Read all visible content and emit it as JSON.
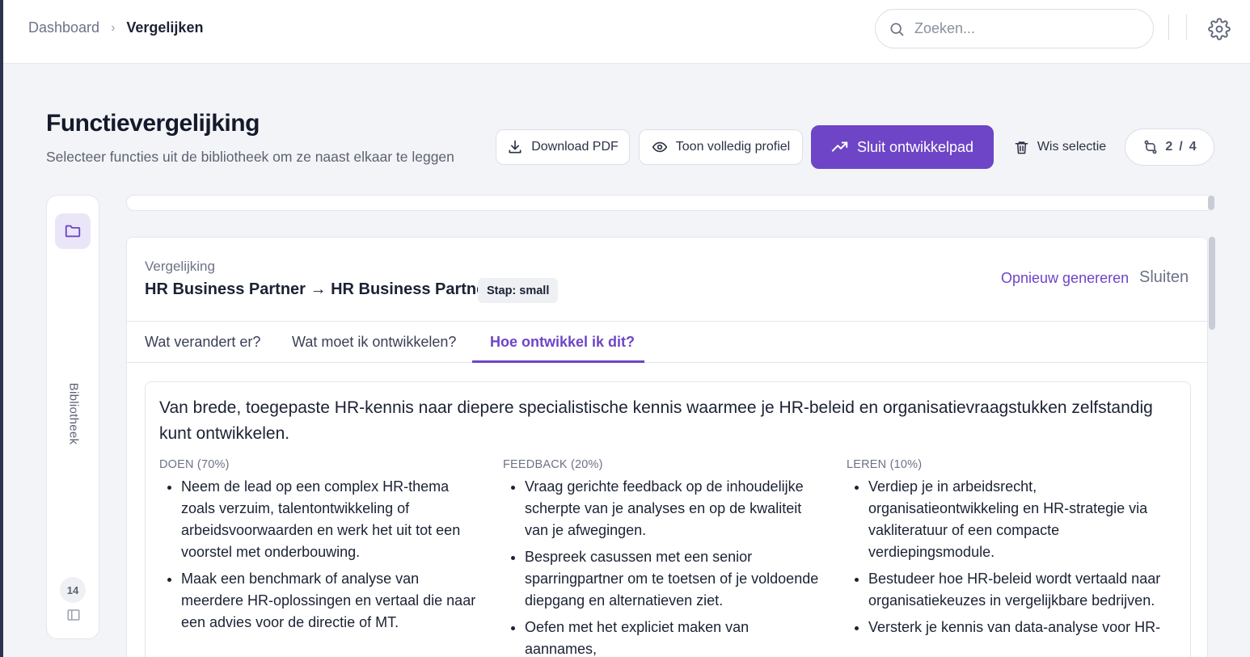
{
  "breadcrumb": {
    "parent": "Dashboard",
    "separator": "›",
    "current": "Vergelijken"
  },
  "search": {
    "placeholder": "Zoeken..."
  },
  "header": {
    "title": "Functievergelijking",
    "subtitle": "Selecteer functies uit de bibliotheek om ze naast elkaar te leggen"
  },
  "toolbar": {
    "download_pdf": "Download PDF",
    "show_profile": "Toon volledig profiel",
    "close_path": "Sluit ontwikkelpad",
    "clear_selection": "Wis selectie",
    "selection_count": "2",
    "selection_sep": "/",
    "selection_total": "4"
  },
  "library": {
    "label": "Bibliotheek",
    "count": "14"
  },
  "comparison": {
    "eyebrow": "Vergelijking",
    "title": "HR Business Partner → HR Business Partner",
    "stage": "Stap: small",
    "regenerate": "Opnieuw genereren",
    "close": "Sluiten",
    "tabs": [
      {
        "label": "Wat verandert er?"
      },
      {
        "label": "Wat moet ik ontwikkelen?"
      },
      {
        "label": "Hoe ontwikkel ik dit?"
      }
    ],
    "active_tab": "Hoe ontwikkel ik dit?",
    "summary": "Van brede, toegepaste HR-kennis naar diepere specialistische kennis waarmee je HR-beleid en organisatievraagstukken zelfstandig kunt ontwikkelen.",
    "columns": [
      {
        "heading": "DOEN (70%)",
        "items": [
          "Neem de lead op een complex HR-thema zoals verzuim, talentontwikkeling of arbeidsvoorwaarden en werk het uit tot een voorstel met onderbouwing.",
          "Maak een benchmark of analyse van meerdere HR-oplossingen en vertaal die naar een advies voor de directie of MT."
        ]
      },
      {
        "heading": "FEEDBACK (20%)",
        "items": [
          "Vraag gerichte feedback op de inhoudelijke scherpte van je analyses en op de kwaliteit van je afwegingen.",
          "Bespreek casussen met een senior sparringpartner om te toetsen of je voldoende diepgang en alternatieven ziet.",
          "Oefen met het expliciet maken van aannames,"
        ]
      },
      {
        "heading": "LEREN (10%)",
        "items": [
          "Verdiep je in arbeidsrecht, organisatieontwikkeling en HR-strategie via vakliteratuur of een compacte verdiepingsmodule.",
          "Bestudeer hoe HR-beleid wordt vertaald naar organisatiekeuzes in vergelijkbare bedrijven.",
          "Versterk je kennis van data-analyse voor HR-"
        ]
      }
    ]
  },
  "colors": {
    "accent": "#6d45c6",
    "background": "#f3f4f7"
  }
}
